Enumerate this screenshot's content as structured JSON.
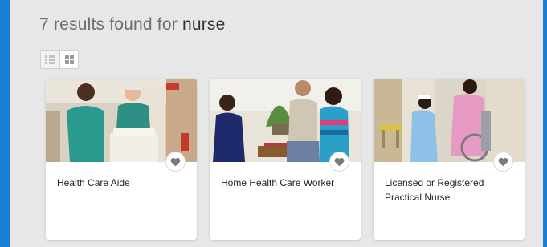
{
  "results": {
    "count": "7",
    "label": "results found for",
    "term": "nurse"
  },
  "view_toggle": {
    "list_icon": "list-view-icon",
    "grid_icon": "grid-view-icon",
    "active": "grid"
  },
  "cards": [
    {
      "title": "Health Care Aide",
      "image": "photo-health-care-aide"
    },
    {
      "title": "Home Health Care Worker",
      "image": "photo-home-health-care-worker"
    },
    {
      "title": "Licensed or Registered Practical Nurse",
      "image": "photo-licensed-practical-nurse"
    }
  ],
  "favorite_icon": "heart-icon",
  "colors": {
    "frame": "#1a7fd4",
    "panel": "#e7e7e7",
    "heading": "#6d6d6d",
    "heart": "#7a7a7a"
  }
}
